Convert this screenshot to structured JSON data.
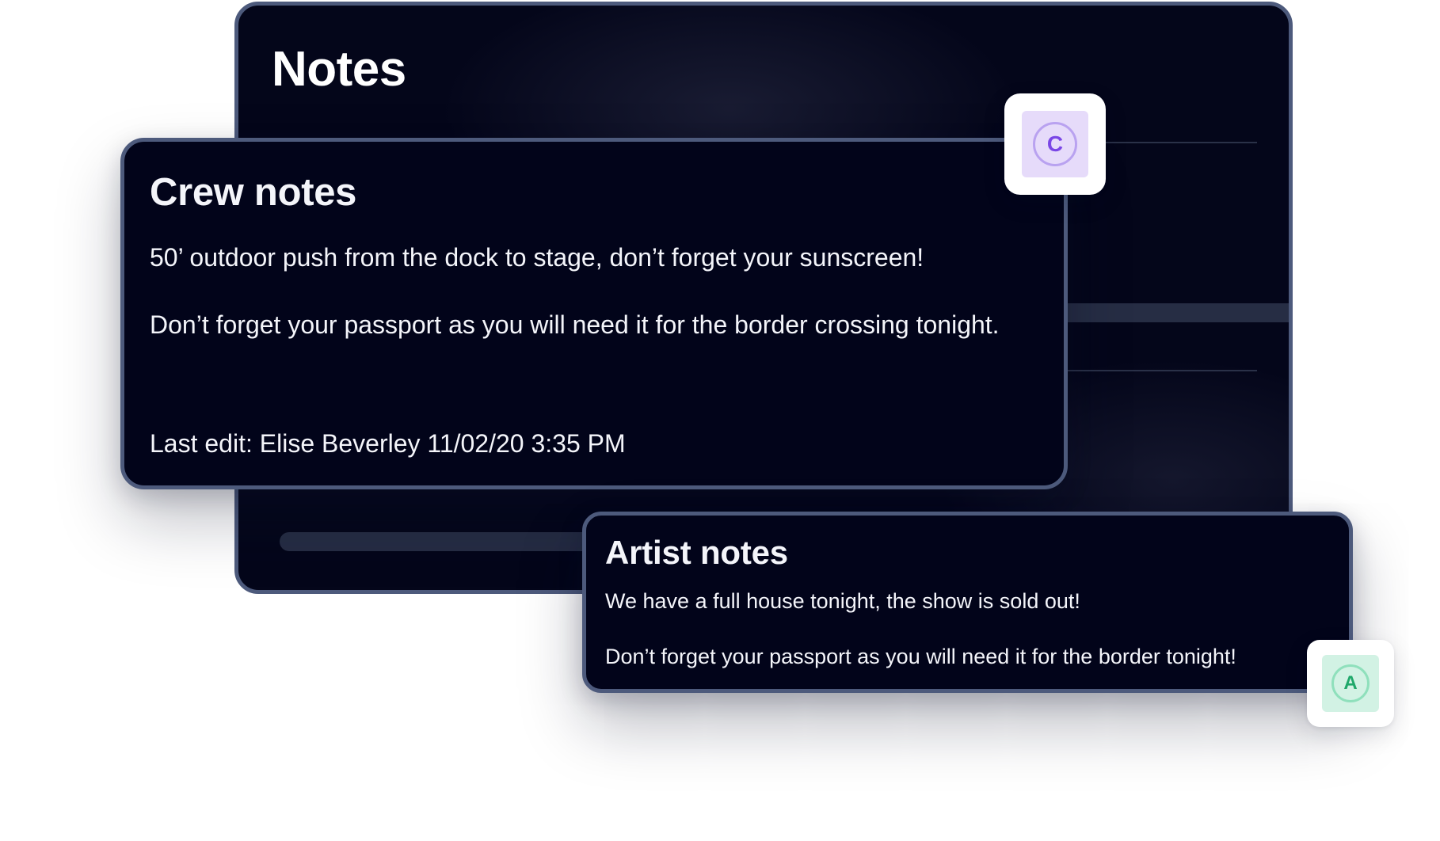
{
  "notes_window": {
    "title": "Notes"
  },
  "crew_notes": {
    "title": "Crew notes",
    "lines": [
      "50’ outdoor push from the dock to stage, don’t forget your sunscreen!",
      "Don’t forget your passport as you will need it for the border crossing tonight."
    ],
    "last_edit": "Last edit: Elise Beverley 11/02/20 3:35 PM",
    "avatar": {
      "initial": "C",
      "color": "#7a46e6",
      "background": "#e6dbfa"
    }
  },
  "artist_notes": {
    "title": "Artist notes",
    "lines": [
      "We have a full house tonight, the show is sold out!",
      "Don’t forget your passport as you will need it for the border tonight!"
    ],
    "avatar": {
      "initial": "A",
      "color": "#1fa86a",
      "background": "#d2f2e4"
    }
  },
  "colors": {
    "card_background": "#02041a",
    "card_border": "#4d5a7c",
    "text": "#f4f5fa"
  }
}
